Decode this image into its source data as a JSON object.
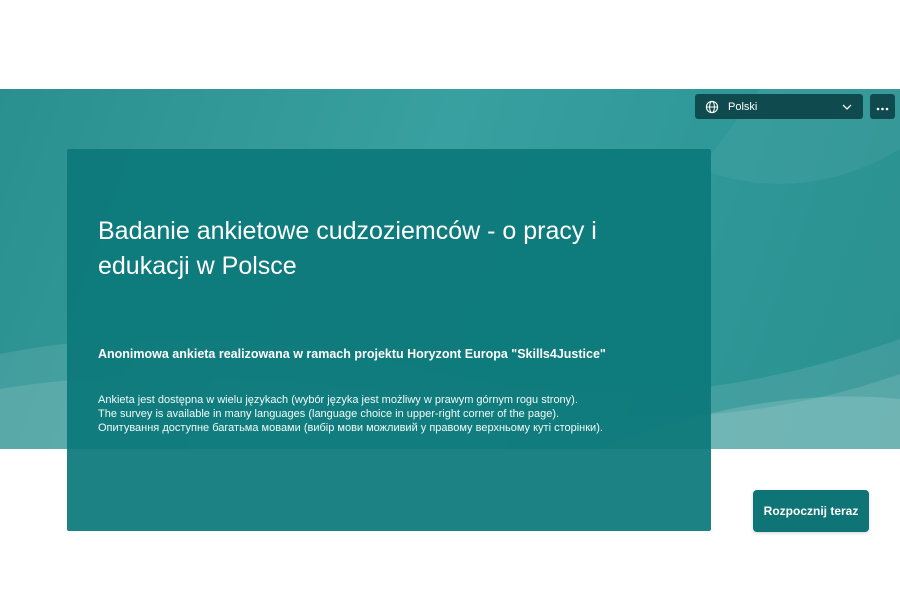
{
  "header": {
    "language_selector": {
      "value": "Polski",
      "icon": "globe-icon",
      "chevron": "chevron-down-icon"
    },
    "more_button": {
      "icon": "more-options-icon"
    }
  },
  "form": {
    "title": "Badanie ankietowe cudzoziemców - o pracy i edukacji w Polsce",
    "subtitle": "Anonimowa ankieta realizowana w ramach projektu Horyzont Europa \"Skills4Justice\"",
    "description": {
      "line_pl": "Ankieta jest dostępna w wielu językach (wybór języka jest możliwy w prawym górnym rogu strony).",
      "line_en": "The survey is available in many languages (language choice in upper-right corner of the page).",
      "line_uk": "Опитування доступне багатьма мовами (вибір мови можливий у правому верхньому куті сторінки)."
    },
    "start_button": "Rozpocznij teraz"
  },
  "colors": {
    "banner": "#2f9898",
    "card": "#0c787a",
    "header_controls": "#0f4b4e",
    "start_button": "#0e7476"
  }
}
